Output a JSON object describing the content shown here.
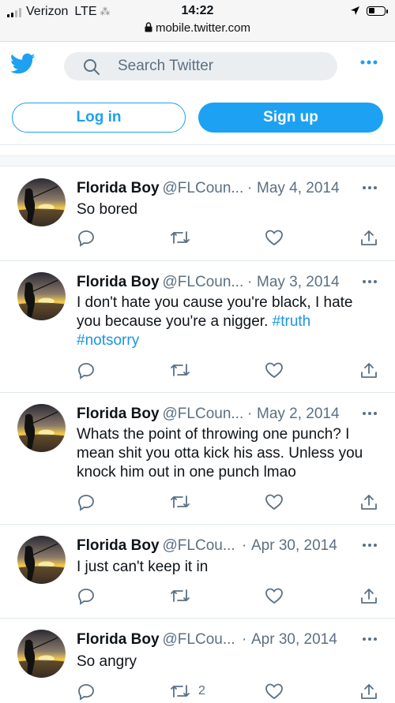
{
  "status_bar": {
    "carrier": "Verizon",
    "network": "LTE",
    "time": "14:22",
    "url": "mobile.twitter.com"
  },
  "header": {
    "search_placeholder": "Search Twitter",
    "login_label": "Log in",
    "signup_label": "Sign up"
  },
  "colors": {
    "brand": "#1da1f2",
    "link": "#1b95e0",
    "muted": "#5b7083"
  },
  "tweets": [
    {
      "name": "Florida Boy",
      "handle": "@FLCoun...",
      "date": "May 4, 2014",
      "text": "So bored",
      "retweets": "",
      "tags": ""
    },
    {
      "name": "Florida Boy",
      "handle": "@FLCoun...",
      "date": "May 3, 2014",
      "text": "I don't hate you cause you're black, I hate\nyou because you're a nigger. ",
      "tag1": "#truth",
      "tag2": "#notsorry",
      "retweets": ""
    },
    {
      "name": "Florida Boy",
      "handle": "@FLCoun...",
      "date": "May 2, 2014",
      "text": "Whats the point of throwing one punch? I\nmean shit you otta kick his ass. Unless you\nknock him out in one punch lmao",
      "retweets": ""
    },
    {
      "name": "Florida Boy",
      "handle": "@FLCou...",
      "date": "Apr 30, 2014",
      "text": "I just can't keep it in",
      "retweets": ""
    },
    {
      "name": "Florida Boy",
      "handle": "@FLCou...",
      "date": "Apr 30, 2014",
      "text": "So angry",
      "retweets": "2"
    }
  ]
}
